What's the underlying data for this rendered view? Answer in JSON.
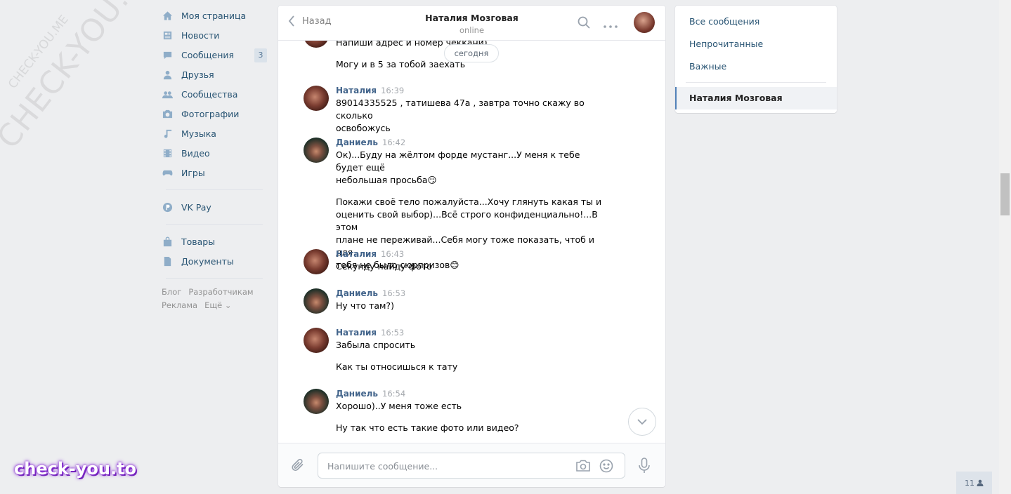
{
  "nav": {
    "items": [
      {
        "label": "Моя страница",
        "icon": "home-icon"
      },
      {
        "label": "Новости",
        "icon": "news-icon"
      },
      {
        "label": "Сообщения",
        "icon": "messages-icon",
        "count": "3"
      },
      {
        "label": "Друзья",
        "icon": "friends-icon"
      },
      {
        "label": "Сообщества",
        "icon": "groups-icon"
      },
      {
        "label": "Фотографии",
        "icon": "camera-icon"
      },
      {
        "label": "Музыка",
        "icon": "music-icon"
      },
      {
        "label": "Видео",
        "icon": "video-icon"
      },
      {
        "label": "Игры",
        "icon": "games-icon"
      }
    ],
    "vkpay": "VK Pay",
    "goods": "Товары",
    "docs": "Документы",
    "footer": [
      "Блог",
      "Разработчикам",
      "Реклама",
      "Ещё ⌄"
    ]
  },
  "chat": {
    "back_label": "Назад",
    "peer_name": "Наталия Мозговая",
    "peer_status": "online",
    "date_divider": "сегодня",
    "messages": [
      {
        "author": "",
        "time": "",
        "lines": [
          "Напиши адрес и номер чеккани)",
          "",
          "Могу и в 5 за тобой заехать"
        ]
      },
      {
        "author": "Наталия",
        "time": "16:39",
        "lines": [
          "89014335525 , татишева 47а , завтра точно скажу во сколько",
          "освобожусь"
        ]
      },
      {
        "author": "Даниель",
        "time": "16:42",
        "lines": [
          "Ок)...Буду на жёлтом форде мустанг...У меня к тебе будет ещё",
          "небольшая просьба😏",
          "",
          "Покажи своё тело пожалуйста...Хочу глянуть какая ты и",
          "оценить свой выбор)...Всё строго конфиденциально!...В этом",
          "плане не переживай...Себя могу тоже показать, чтоб и для",
          "тебя не было сюрпризов😊"
        ]
      },
      {
        "author": "Наталия",
        "time": "16:43",
        "lines": [
          "Секунду найду фото"
        ]
      },
      {
        "author": "Даниель",
        "time": "16:53",
        "lines": [
          "Ну что там?)"
        ]
      },
      {
        "author": "Наталия",
        "time": "16:53",
        "lines": [
          "Забыла спросить",
          "",
          "Как ты относишься к тату"
        ]
      },
      {
        "author": "Даниель",
        "time": "16:54",
        "lines": [
          "Хорошо)..У меня тоже есть",
          "",
          "Ну так что есть такие фото или видео?"
        ]
      }
    ],
    "input_placeholder": "Напишите сообщение..."
  },
  "right_panel": {
    "all": "Все сообщения",
    "unread": "Непрочитанные",
    "important": "Важные",
    "active_dialog": "Наталия Мозговая"
  },
  "watermark": {
    "big": "CHECK-YOU.ME",
    "small": "CHECK-YOU.ME",
    "brand": "check-you.to"
  },
  "online_count": "11"
}
